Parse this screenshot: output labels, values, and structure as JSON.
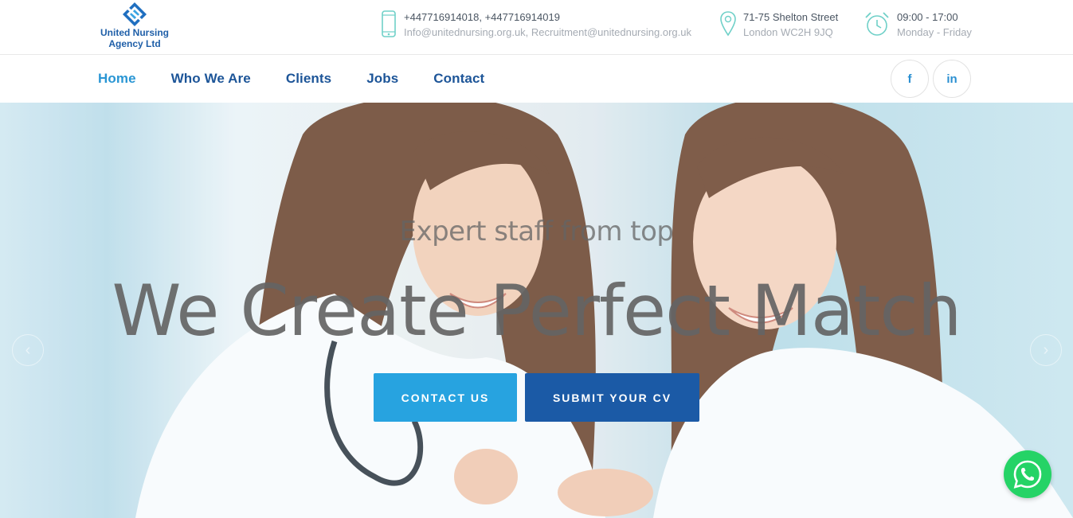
{
  "logo": {
    "line1": "United Nursing",
    "line2": "Agency Ltd",
    "icon": "diamond-logo-icon"
  },
  "contact": {
    "phones": "+447716914018, +447716914019",
    "emails": "Info@unitednursing.org.uk, Recruitment@unitednursing.org.uk",
    "icon": "phone-icon"
  },
  "address": {
    "line1": "71-75 Shelton Street",
    "line2": "London WC2H 9JQ",
    "icon": "map-pin-icon"
  },
  "hours": {
    "time": "09:00 - 17:00",
    "days": "Monday - Friday",
    "icon": "alarm-clock-icon"
  },
  "nav": {
    "items": [
      "Home",
      "Who We Are",
      "Clients",
      "Jobs",
      "Contact"
    ],
    "active": "Home"
  },
  "social": {
    "facebook": "f",
    "linkedin": "in"
  },
  "hero": {
    "subtitle": "Expert staff from top",
    "headline": "We Create Perfect Match",
    "buttons": {
      "contact": "CONTACT US",
      "cv": "SUBMIT YOUR CV"
    },
    "prev_icon": "chevron-left-icon",
    "next_icon": "chevron-right-icon"
  },
  "whatsapp": {
    "icon": "whatsapp-icon"
  },
  "colors": {
    "primary": "#1d5598",
    "accent": "#2a96d4",
    "button_light": "#27a3e0",
    "button_dark": "#1b5aa6",
    "info_icon": "#6fd0c8",
    "whatsapp": "#25d366"
  }
}
